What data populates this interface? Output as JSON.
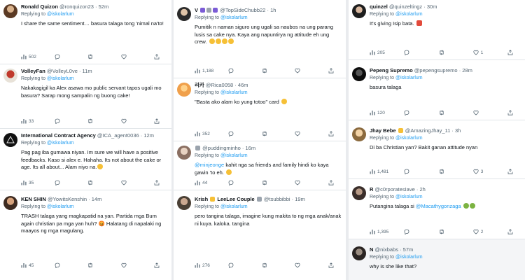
{
  "reply_prefix": "Replying to",
  "reply_handle": "@iskolarlum",
  "colors": {
    "link": "#1d9bf0",
    "text": "#0f1419",
    "muted": "#536471"
  },
  "icons": [
    "reply-icon",
    "retweet-icon",
    "like-icon",
    "views-icon",
    "share-icon"
  ],
  "columns": [
    {
      "tweets": [
        {
          "name": "Ronald Quizon",
          "handle": "@ronquizon23",
          "time": "52m",
          "text": "I share the same sentiment… basura talaga tong 'nimal na'to!",
          "views": "502"
        },
        {
          "name": "VolleyFan",
          "handle": "@VolleyL0ve",
          "time": "11m",
          "text": "Nakakagigil ka Alex asawa mo public servant tapos ugali mo basura? Sarap mong sampalin ng buong cake!",
          "views": "33"
        },
        {
          "name": "International Contract Agency",
          "handle": "@ICA_agent0036",
          "time": "12m",
          "text": "Pag pag iba gumawa niyan. Im sure we will have a positive feedbacks. Kaso si alex e. Hahaha. Its not about the cake or age. Its all about... Alam niyo na.",
          "views": "35"
        },
        {
          "name": "KEN SHIN",
          "handle": "@YowitsKenshin",
          "time": "14m",
          "text": "TRASH talaga yang magkapatid na yan. Partida mga Bum again christian pa mga yan huh? 😡 Halatang di napalaki ng maayos ng mga magulang.",
          "views": "45"
        }
      ]
    },
    {
      "tweets": [
        {
          "name": "V",
          "handle": "@TopSideChubb22",
          "time": "1h",
          "text": "Pumitik n naman siguro ung ugali sa naubos na ung parang lusis sa cake nya. Kaya ang napuntirya ng attitude eh ung crew.",
          "views": "1,188"
        },
        {
          "name": "리카",
          "handle": "@Rica0058",
          "time": "46m",
          "text": "\"Basta ako alam ko yung totoo\" card",
          "views": "352"
        },
        {
          "name": "",
          "handle": "@puddingminho",
          "time": "16m",
          "mention": "@minjeonge",
          "text": " kahit nga sa friends and family hindi ko kaya gawin 'to eh.",
          "views": "44"
        },
        {
          "name": "Krish",
          "name_suffix": "LeeLee Couple",
          "handle": "@tsubbibbi",
          "time": "19m",
          "text": "pero tangina talaga, imagine kung makita to ng mga anak/anak ni kuya. kaloka. tangina",
          "views": "276"
        }
      ]
    },
    {
      "tweets": [
        {
          "name": "quinzel",
          "handle": "@quinzeltingz",
          "time": "30m",
          "text": "It's giving Isip bata.",
          "views": "205",
          "likes": "1"
        },
        {
          "name": "Pepeng Supremo",
          "handle": "@pepengsupremo",
          "time": "28m",
          "text": "basura talaga",
          "views": "120"
        },
        {
          "name": "Jhay Bebe",
          "handle": "@AmazingJhay_11",
          "time": "3h",
          "text": "Di ba Christian yan? Bakit ganan attitude nyan",
          "views": "1,481",
          "likes": "3"
        },
        {
          "name": "R",
          "handle": "@c0rporatesIave",
          "time": "2h",
          "text": "Putangina talaga si ",
          "mention_after": "@Macathygonzaga",
          "views": "1,395",
          "likes": "2"
        },
        {
          "name": "N",
          "handle": "@nixbabs",
          "time": "57m",
          "text": "why is she like that?",
          "views": ""
        }
      ]
    }
  ]
}
